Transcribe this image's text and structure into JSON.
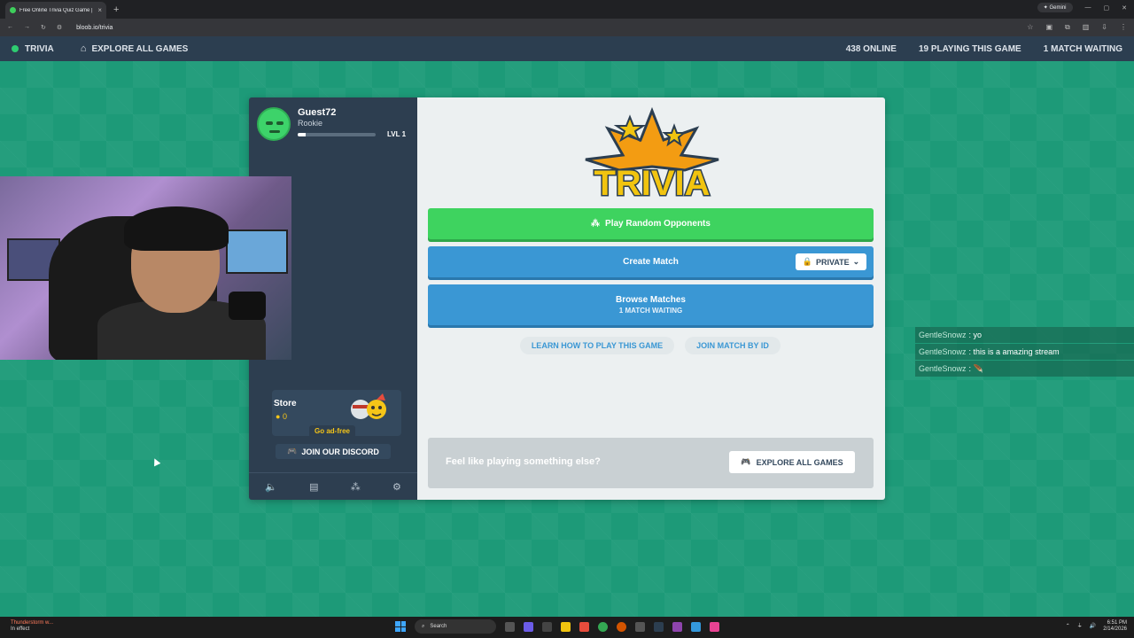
{
  "browser": {
    "tab_title": "Free Online Trivia Quiz Game |",
    "url": "bloob.io/trivia",
    "gemini_label": "Gemini"
  },
  "header": {
    "game_name": "TRIVIA",
    "explore_label": "EXPLORE ALL GAMES",
    "online": "438 ONLINE",
    "playing": "19 PLAYING THIS GAME",
    "waiting": "1 MATCH WAITING"
  },
  "profile": {
    "username": "Guest72",
    "rank": "Rookie",
    "level": "LVL 1",
    "xp_fraction": 0.1
  },
  "sidebar": {
    "store_label": "Store",
    "coins": "0",
    "adfree_label": "Go ad-free",
    "discord_label": "JOIN OUR DISCORD"
  },
  "main": {
    "logo_text": "TRIVIA",
    "play_random": "Play Random Opponents",
    "create_match": "Create Match",
    "privacy": "PRIVATE",
    "browse": "Browse Matches",
    "browse_sub": "1 MATCH WAITING",
    "learn": "LEARN HOW TO PLAY THIS GAME",
    "join_by_id": "JOIN MATCH BY ID",
    "promo_text": "Feel like playing something else?",
    "promo_button": "EXPLORE ALL GAMES"
  },
  "chat": [
    {
      "name": "GentleSnowz",
      "message": "yo"
    },
    {
      "name": "GentleSnowz",
      "message": "this is a amazing stream"
    },
    {
      "name": "GentleSnowz",
      "message": "🪶"
    }
  ],
  "taskbar": {
    "weather_title": "Thunderstorm w...",
    "weather_sub": "In effect",
    "search": "Search",
    "time": "6:51 PM",
    "date": "2/14/2026"
  },
  "colors": {
    "background": "#1d9a78",
    "header": "#2c3e50",
    "green_button": "#3ed35f",
    "blue_button": "#3a97d4"
  }
}
